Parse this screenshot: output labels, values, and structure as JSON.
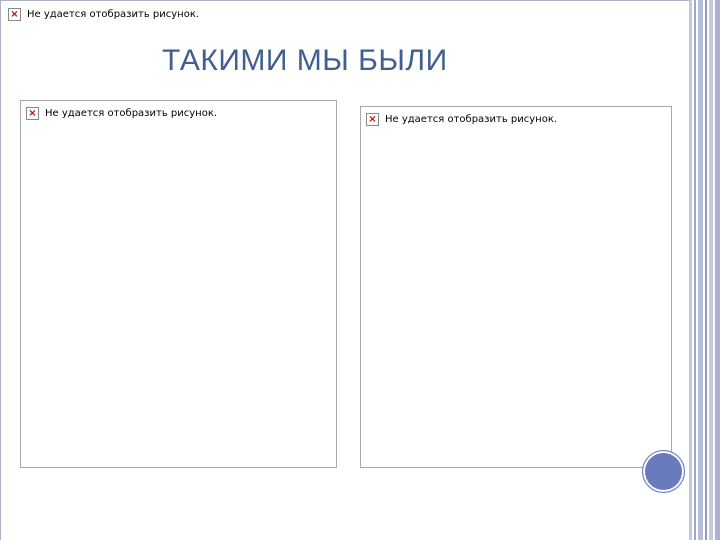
{
  "slide": {
    "title": "ТАКИМИ МЫ БЫЛИ",
    "broken_image_text": "Не удается отобразить рисунок.",
    "broken_icon": "broken-image-icon"
  },
  "colors": {
    "title": "#3f5f91",
    "accent_circle": "#6a7bbd",
    "stripe_band": "#a9b1d6"
  }
}
